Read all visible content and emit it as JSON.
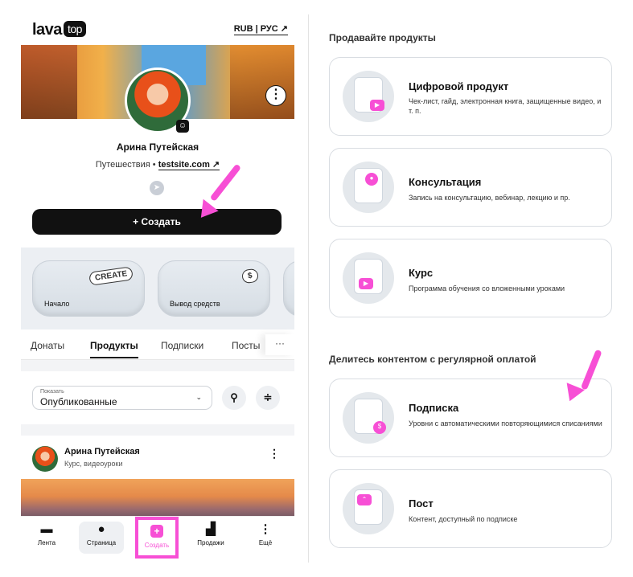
{
  "app": {
    "logo": "lava",
    "logo_badge": "top",
    "lang_switch": "RUB | РУС ↗"
  },
  "profile": {
    "name": "Арина Путейская",
    "category": "Путешествия •",
    "site": "testsite.com ↗",
    "create_button": "+ Создать"
  },
  "quick_tiles": [
    {
      "label": "Начало",
      "picture": "CREATE"
    },
    {
      "label": "Вывод средств",
      "picture": "$"
    }
  ],
  "tabs": [
    "Донаты",
    "Продукты",
    "Подписки",
    "Посты"
  ],
  "tabs_more": "···",
  "filter": {
    "caption": "Показать",
    "value": "Опубликованные",
    "chevron": "⌄"
  },
  "post": {
    "author": "Арина Путейская",
    "meta": "Курс, видеоуроки",
    "menu": "⋮"
  },
  "bottom_nav": {
    "feed": "Лента",
    "page": "Страница",
    "create": "Создать",
    "sales": "Продажи",
    "more": "Ещё"
  },
  "right": {
    "section1": "Продавайте продукты",
    "section2": "Делитесь контентом с регулярной оплатой",
    "cards": [
      {
        "title": "Цифровой продукт",
        "desc": "Чек-лист, гайд, электронная книга, защищенные видео, и т. п."
      },
      {
        "title": "Консультация",
        "desc": "Запись на консультацию, вебинар, лекцию и пр."
      },
      {
        "title": "Курс",
        "desc": "Программа обучения со вложенными уроками"
      },
      {
        "title": "Подписка",
        "desc": "Уровни с автоматическими повторяющимися списаниями"
      },
      {
        "title": "Пост",
        "desc": "Контент, доступный по подписке"
      }
    ]
  },
  "colors": {
    "accent_pink": "#f74fd5",
    "dark": "#111111",
    "card_border": "#d9dde2"
  }
}
